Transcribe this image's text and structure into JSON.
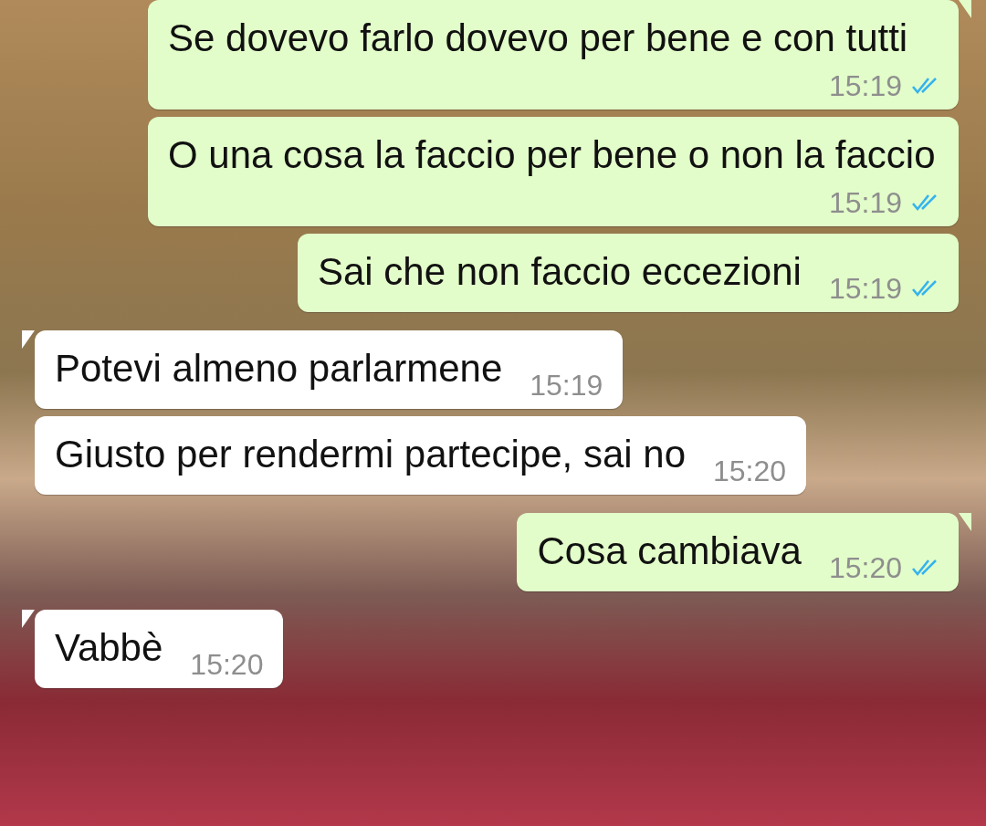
{
  "messages": [
    {
      "kind": "outgoing",
      "tail": true,
      "text": "Se dovevo farlo dovevo per bene e con tutti",
      "time": "15:19",
      "read": true
    },
    {
      "kind": "outgoing",
      "tail": false,
      "text": "O una cosa la faccio per bene o non la faccio",
      "time": "15:19",
      "read": true
    },
    {
      "kind": "outgoing",
      "tail": false,
      "text": "Sai che non faccio eccezioni",
      "time": "15:19",
      "read": true
    },
    {
      "kind": "incoming",
      "tail": true,
      "text": "Potevi almeno parlarmene",
      "time": "15:19"
    },
    {
      "kind": "incoming",
      "tail": false,
      "text": "Giusto per rendermi partecipe, sai no",
      "time": "15:20"
    },
    {
      "kind": "outgoing",
      "tail": true,
      "text": "Cosa cambiava",
      "time": "15:20",
      "read": true
    },
    {
      "kind": "incoming",
      "tail": true,
      "text": "Vabbè",
      "time": "15:20"
    }
  ]
}
